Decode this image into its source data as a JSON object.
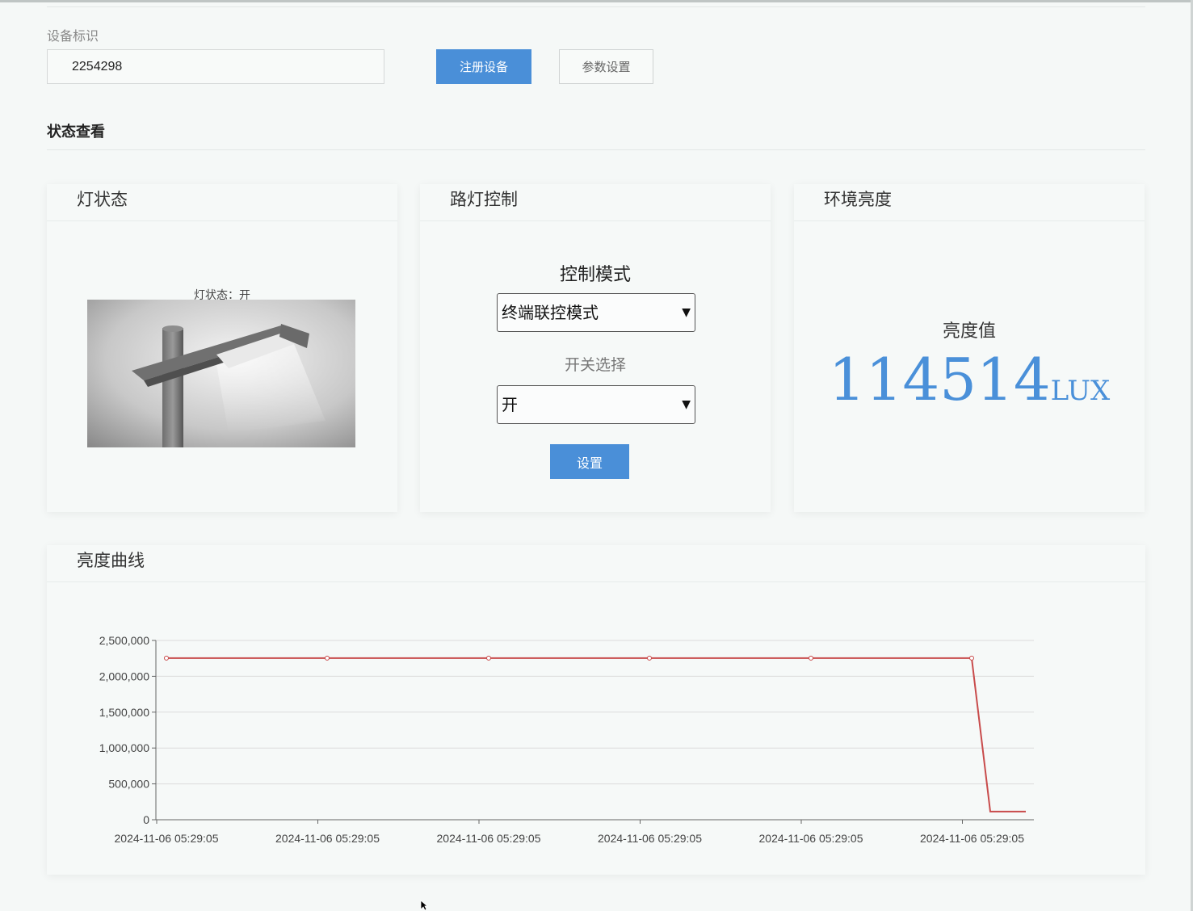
{
  "device": {
    "label": "设备标识",
    "id_value": "2254298",
    "register_button": "注册设备",
    "params_button": "参数设置"
  },
  "status_section": {
    "title": "状态查看"
  },
  "lamp_card": {
    "title": "灯状态",
    "caption": "灯状态：开"
  },
  "control_card": {
    "title": "路灯控制",
    "mode_label": "控制模式",
    "mode_selected": "终端联控模式",
    "switch_label": "开关选择",
    "switch_selected": "开",
    "set_button": "设置"
  },
  "brightness_card": {
    "title": "环境亮度",
    "value_label": "亮度值",
    "value": "114514",
    "unit": "LUX"
  },
  "curve_card": {
    "title": "亮度曲线"
  },
  "colors": {
    "accent": "#4a8fd8",
    "line": "#c84b4b",
    "value_text": "#4a90d9"
  },
  "chart_data": {
    "type": "line",
    "ylim": [
      0,
      2500000
    ],
    "y_ticks": [
      "0",
      "500,000",
      "1,000,000",
      "1,500,000",
      "2,000,000",
      "2,500,000"
    ],
    "x_tick_labels": [
      "2024-11-06 05:29:05",
      "2024-11-06 05:29:05",
      "2024-11-06 05:29:05",
      "2024-11-06 05:29:05",
      "2024-11-06 05:29:05",
      "2024-11-06 05:29:05"
    ],
    "series": [
      {
        "values": [
          2254298,
          2254298,
          2254298,
          2254298,
          2254298,
          2254298,
          114514,
          114514
        ]
      }
    ],
    "grid": true
  }
}
